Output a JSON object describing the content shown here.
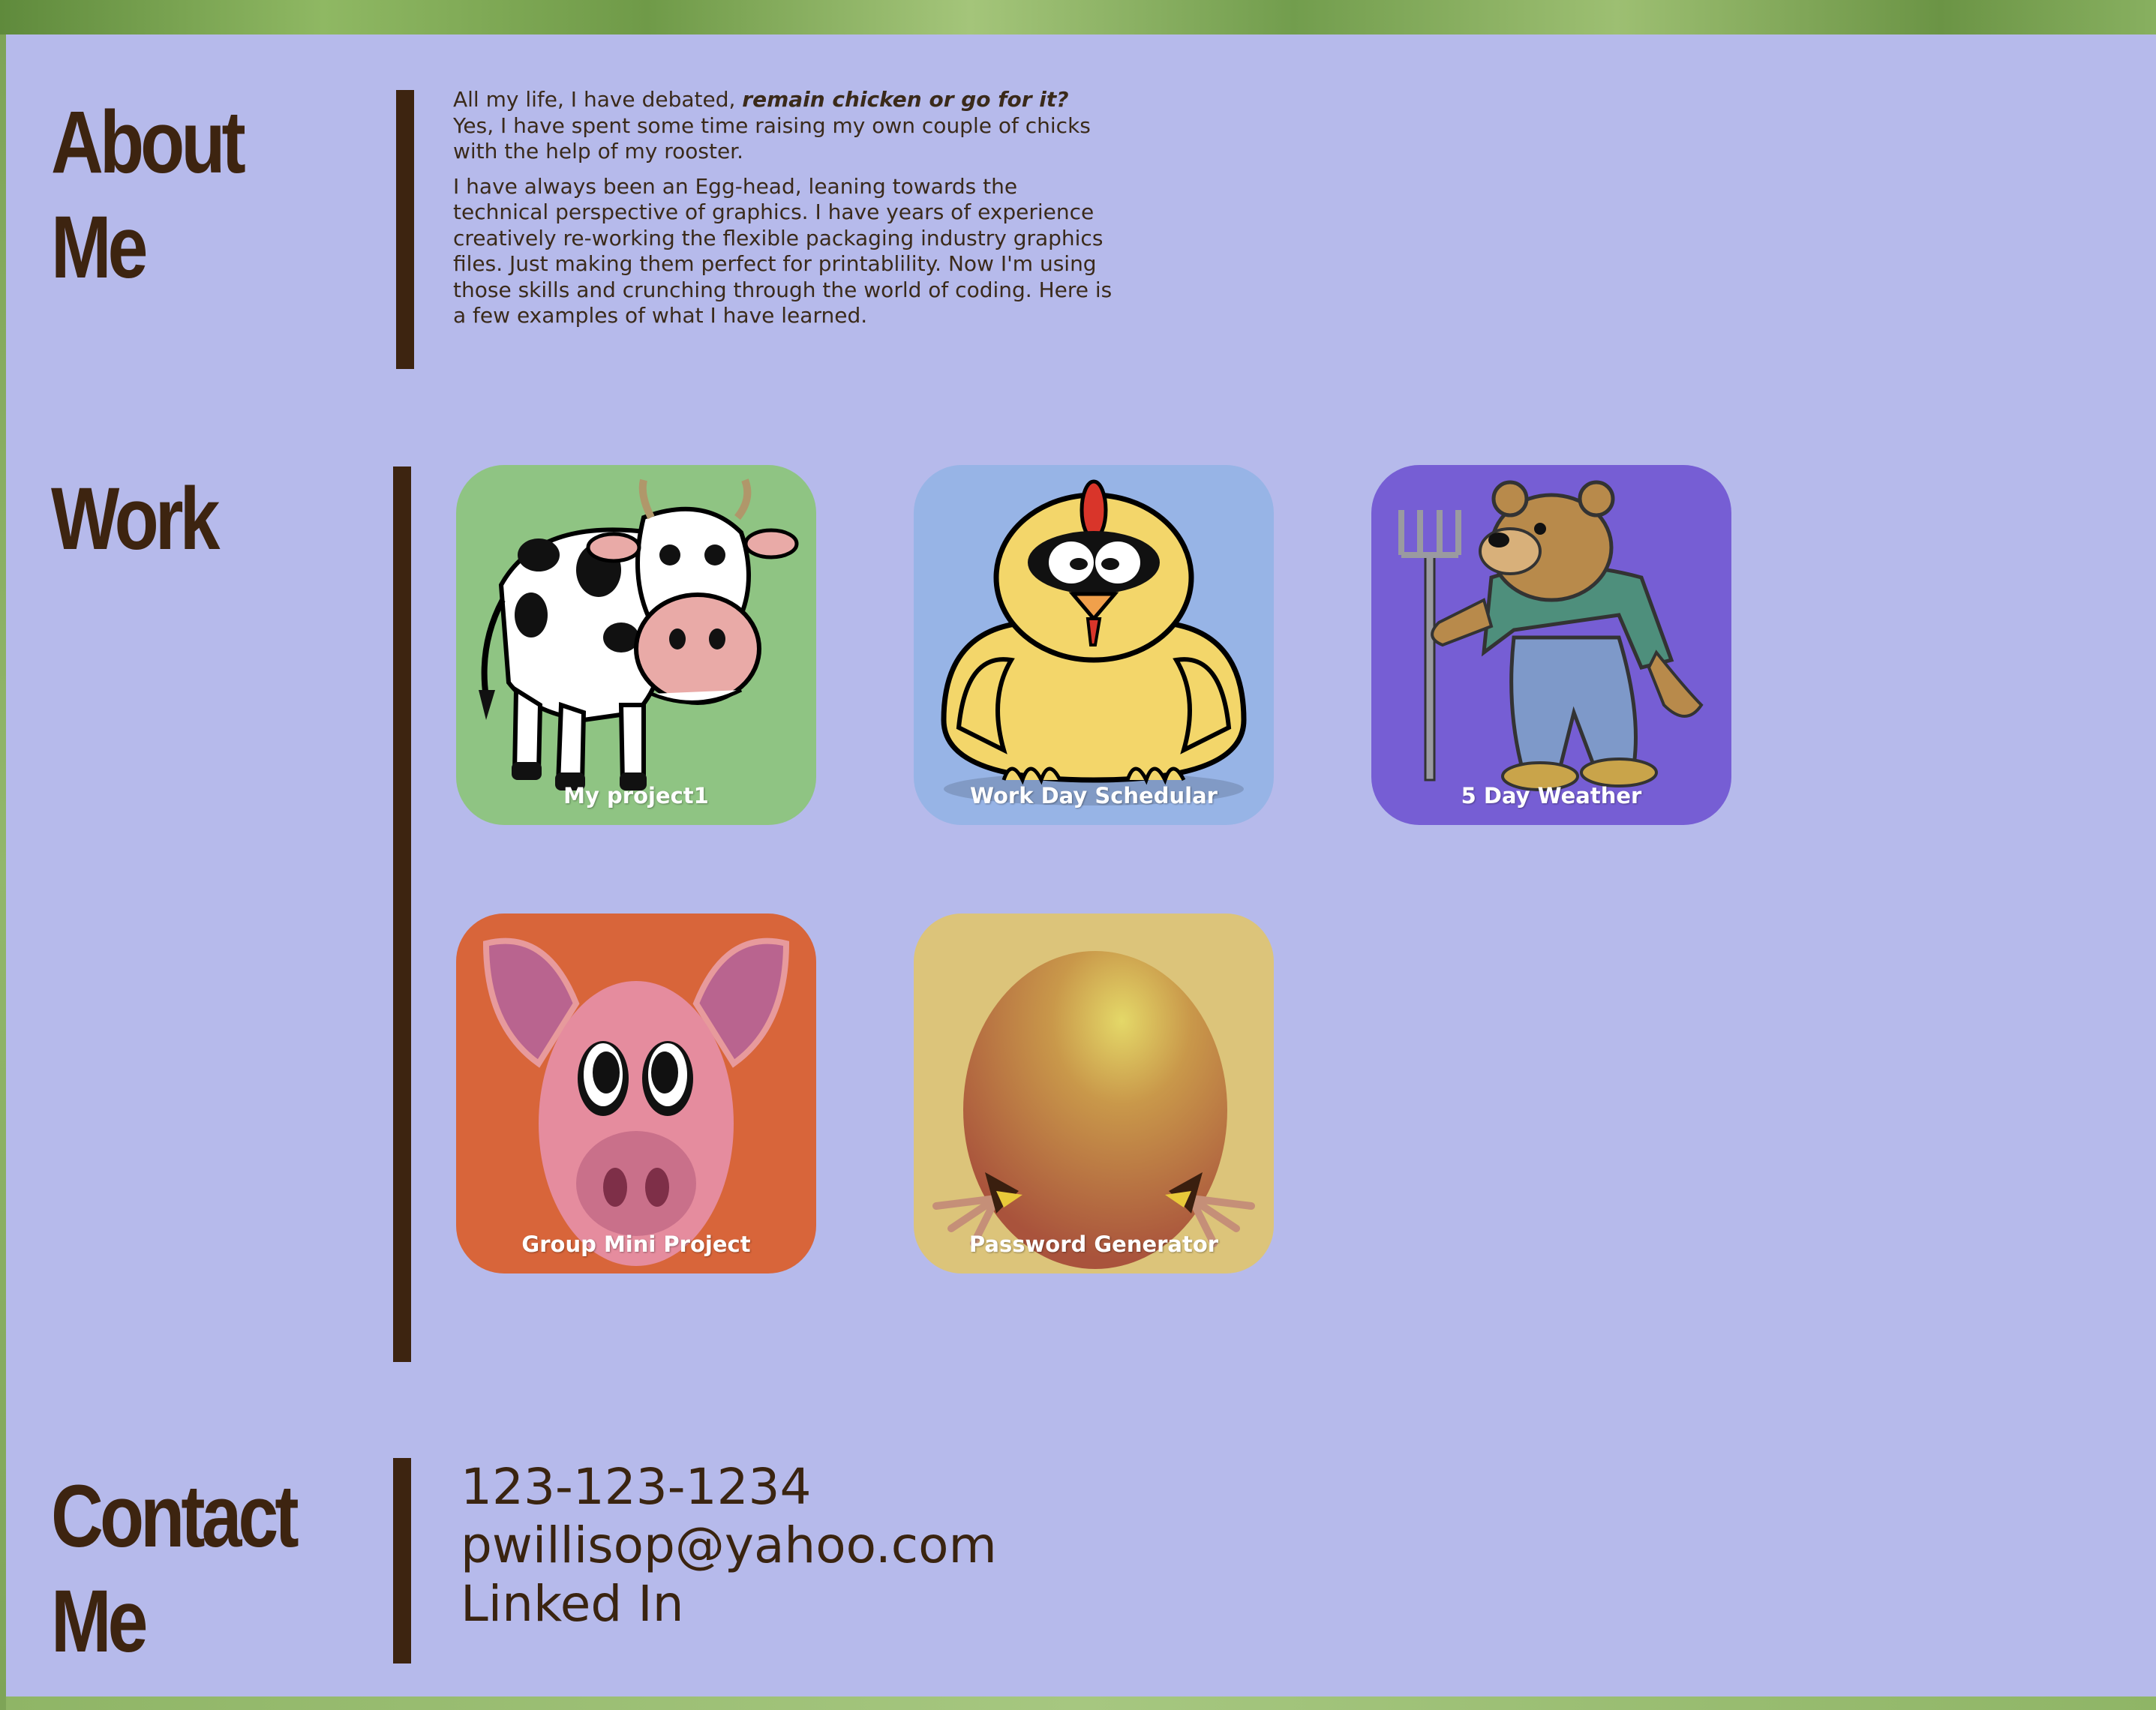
{
  "about": {
    "heading_line1": "About",
    "heading_line2": "Me",
    "intro_plain": "All my life, I have debated, ",
    "intro_emphasis": "remain chicken or go for it?",
    "intro_rest": " Yes, I have spent some time raising my own couple of chicks with the help of my rooster.",
    "paragraph2": "I have always been an Egg-head, leaning towards the technical perspective of graphics. I have years of experience creatively re-working the flexible packaging industry graphics files. Just making them perfect for printablility. Now I'm using those skills and crunching through the world of coding. Here is a few examples of what I have learned."
  },
  "work": {
    "heading": "Work",
    "projects": [
      {
        "label": "My project1",
        "bg_color": "#8fc483",
        "icon": "cow-icon"
      },
      {
        "label": "Work Day Schedular",
        "bg_color": "#97b4e6",
        "icon": "chick-icon"
      },
      {
        "label": "5 Day Weather",
        "bg_color": "#765ed4",
        "icon": "farmer-bear-icon"
      },
      {
        "label": "Group Mini Project",
        "bg_color": "#d8653a",
        "icon": "pig-icon"
      },
      {
        "label": "Password Generator",
        "bg_color": "#dcc47a",
        "icon": "egg-icon"
      }
    ]
  },
  "contact": {
    "heading_line1": "Contact",
    "heading_line2": "Me",
    "phone": "123-123-1234",
    "email": "pwillisop@yahoo.com",
    "linkedin": "Linked In"
  },
  "colors": {
    "page_background": "#b6baeb",
    "heading_text": "#3d2410",
    "divider": "#3d2410"
  }
}
